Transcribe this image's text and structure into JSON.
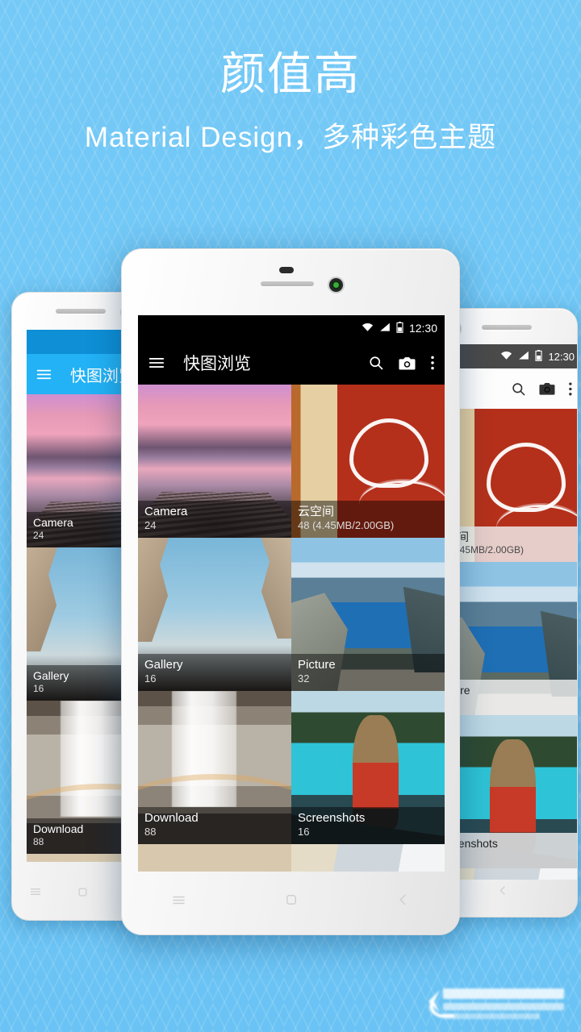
{
  "page": {
    "title": "颜值高",
    "subtitle": "Material Design，多种彩色主题",
    "background_color": "#6EC6F5",
    "heading_color": "#FFFFFF"
  },
  "watermark": {
    "name": "blurred-brand-logo"
  },
  "status_bar": {
    "time": "12:30",
    "icons": [
      "wifi-icon",
      "signal-icon",
      "battery-icon"
    ]
  },
  "toolbar": {
    "app_title": "快图浏览",
    "menu_icon": "hamburger-menu-icon",
    "search_icon": "search-icon",
    "camera_icon": "camera-icon",
    "overflow_icon": "overflow-menu-icon"
  },
  "nav_bar": {
    "menu_label": "menu-nav-icon",
    "home_label": "home-nav-icon",
    "back_label": "back-nav-icon"
  },
  "folders": [
    {
      "name": "Camera",
      "count": "24",
      "art": "ph-pier"
    },
    {
      "name": "云空间",
      "count": "48 (4.45MB/2.00GB)",
      "art": "ph-cloudwall"
    },
    {
      "name": "Gallery",
      "count": "16",
      "art": "ph-cathedral"
    },
    {
      "name": "Picture",
      "count": "32",
      "art": "ph-fjord"
    },
    {
      "name": "Download",
      "count": "88",
      "art": "ph-waterfall"
    },
    {
      "name": "Screenshots",
      "count": "16",
      "art": "ph-canoe"
    },
    {
      "name": "",
      "count": "",
      "art": "ph-bird"
    },
    {
      "name": "",
      "count": "",
      "art": "ph-bed"
    }
  ],
  "phones": [
    {
      "id": "left",
      "theme": "blue",
      "theme_color": "#22B2F5",
      "status_color": "#0E8FD6",
      "label": "phone-left-blue-theme"
    },
    {
      "id": "center",
      "theme": "dark",
      "theme_color": "#000000",
      "status_color": "#000000",
      "label": "phone-center-dark-theme"
    },
    {
      "id": "right",
      "theme": "light",
      "theme_color": "#FDFDFD",
      "status_color": "#4A4A4A",
      "label": "phone-right-light-theme"
    }
  ]
}
